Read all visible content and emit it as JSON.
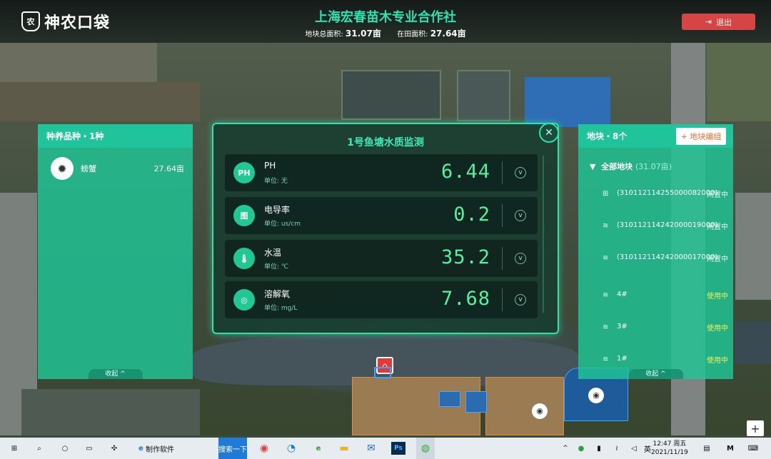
{
  "header": {
    "logo_text": "神农口袋",
    "logo_icon": "bag-icon",
    "title": "上海宏春苗木专业合作社",
    "total_area_label": "地块总面积:",
    "total_area_value": "31.07亩",
    "field_area_label": "在田面积:",
    "field_area_value": "27.64亩",
    "logout_label": "退出",
    "logout_icon": "logout-icon"
  },
  "left_panel": {
    "title": "种养品种・1种",
    "items": [
      {
        "icon": "crab-icon",
        "name": "螃蟹",
        "value": "27.64亩"
      }
    ],
    "collapse_label": "收起"
  },
  "monitor": {
    "title": "1号鱼塘水质监测",
    "rows": [
      {
        "badge": "PH",
        "label": "PH",
        "unit": "单位: 无",
        "value": "6.44"
      },
      {
        "badge": "图",
        "label": "电导率",
        "unit": "单位: us/cm",
        "value": "0.2"
      },
      {
        "badge": "🌡",
        "label": "水温",
        "unit": "单位: ℃",
        "value": "35.2"
      },
      {
        "badge": "◎",
        "label": "溶解氧",
        "unit": "单位: mg/L",
        "value": "7.68"
      }
    ]
  },
  "right_panel": {
    "title": "地块・8个",
    "group_button": "地块编组",
    "all_label": "全部地块",
    "all_count": "(31.07亩)",
    "plots": [
      {
        "name": "(310112114255000082000)",
        "status": "闲置中"
      },
      {
        "name": "(310112114242000019000)",
        "status": "闲置中"
      },
      {
        "name": "(310112114242000017000)",
        "status": "闲置中"
      },
      {
        "name": "4#",
        "status": "使用中"
      },
      {
        "name": "3#",
        "status": "使用中"
      },
      {
        "name": "1#",
        "status": "使用中"
      }
    ],
    "collapse_label": "收起"
  },
  "map": {
    "zoom_in": "+"
  },
  "taskbar": {
    "app_label": "制作软件",
    "search_label": "搜索一下",
    "time": "12:47 周五",
    "date": "2021/11/19",
    "ime": "英"
  }
}
